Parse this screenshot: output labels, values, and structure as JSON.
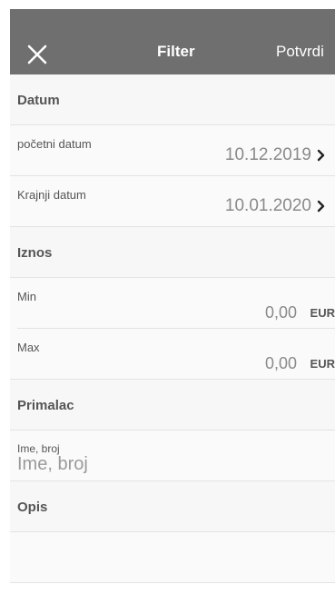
{
  "header": {
    "close_icon": "close-icon",
    "title": "Filter",
    "confirm_label": "Potvrdi"
  },
  "date_section": {
    "label": "Datum",
    "start": {
      "label": "početni datum",
      "value": "10.12.2019",
      "icon": "chevron-right-icon"
    },
    "end": {
      "label": "Krajnji datum",
      "value": "10.01.2020",
      "icon": "chevron-right-icon"
    }
  },
  "amount_section": {
    "label": "Iznos",
    "min": {
      "label": "Min",
      "value": "0,00",
      "currency": "EUR"
    },
    "max": {
      "label": "Max",
      "value": "0,00",
      "currency": "EUR"
    }
  },
  "recipient_section": {
    "label": "Primalac",
    "field_label": "Ime, broj",
    "placeholder": "Ime, broj"
  },
  "description_section": {
    "label": "Opis"
  },
  "colors": {
    "header_bg": "#6f6f6f",
    "section_bg": "#f7f7f7",
    "row_bg": "#fafafa",
    "muted_text": "#8a8a8a"
  }
}
